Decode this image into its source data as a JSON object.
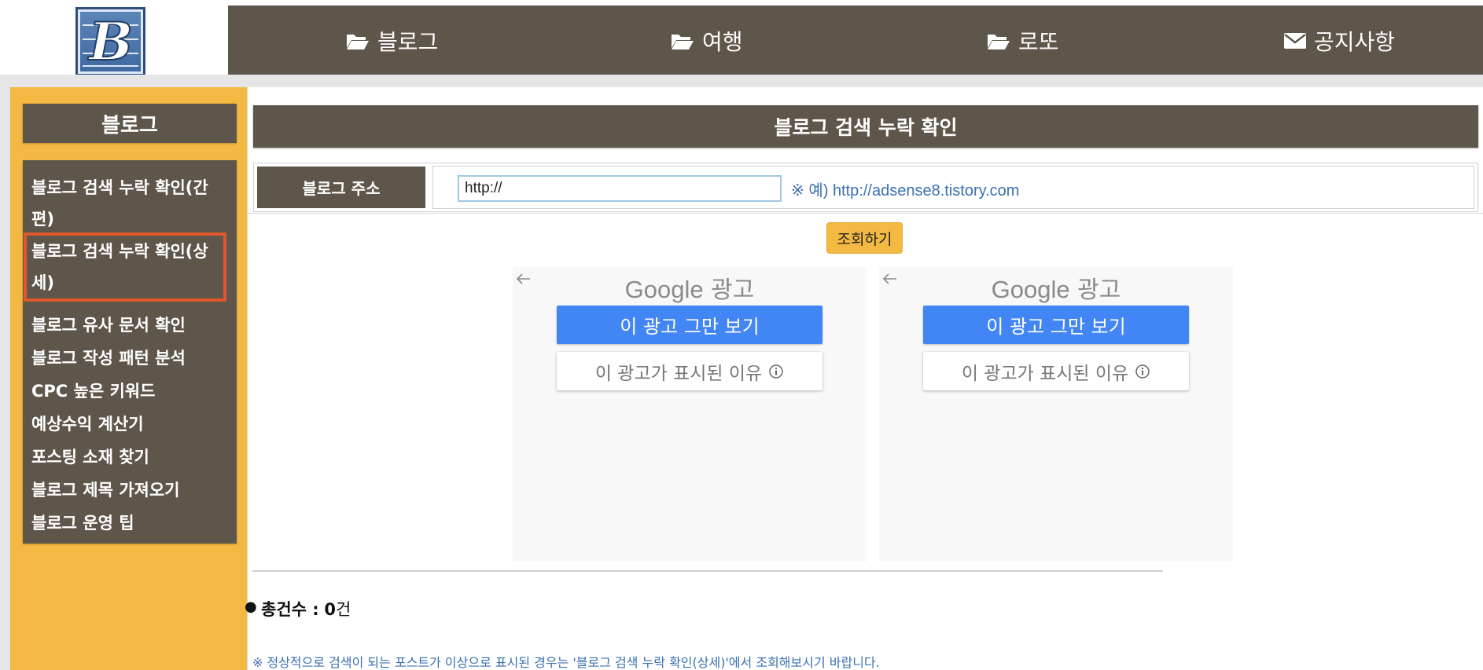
{
  "header": {
    "logo_letter": "B",
    "nav": [
      {
        "label": "블로그",
        "icon": "folder-open-icon"
      },
      {
        "label": "여행",
        "icon": "folder-open-icon"
      },
      {
        "label": "로또",
        "icon": "folder-open-icon"
      },
      {
        "label": "공지사항",
        "icon": "envelope-icon"
      }
    ]
  },
  "sidebar": {
    "title": "블로그",
    "items": [
      {
        "label": "블로그 검색 누락 확인(간편)"
      },
      {
        "label": "블로그 검색 누락 확인(상세)",
        "active": true
      },
      {
        "label": "블로그 유사 문서 확인"
      },
      {
        "label": "블로그 작성 패턴 분석"
      },
      {
        "label": "CPC 높은 키워드"
      },
      {
        "label": "예상수익 계산기"
      },
      {
        "label": "포스팅 소재 찾기"
      },
      {
        "label": "블로그 제목 가져오기"
      },
      {
        "label": "블로그 운영 팁"
      }
    ]
  },
  "main": {
    "title": "블로그 검색 누락 확인",
    "form": {
      "label": "블로그 주소",
      "url_value": "http://",
      "example_prefix": "※ 예)",
      "example_url": "http://adsense8.tistory.com"
    },
    "search_button": "조회하기",
    "ads": [
      {
        "brand": "Google",
        "brand_suffix": "광고",
        "stop_label": "이 광고 그만 보기",
        "why_label": "이 광고가 표시된 이유"
      },
      {
        "brand": "Google",
        "brand_suffix": "광고",
        "stop_label": "이 광고 그만 보기",
        "why_label": "이 광고가 표시된 이유"
      }
    ],
    "total": {
      "label": "총건수 :",
      "count": "0",
      "unit": "건"
    },
    "note": "※ 정상적으로 검색이 되는 포스트가 이상으로 표시된 경우는 '블로그 검색 누락 확인(상세)'에서 조회해보시기 바랍니다."
  },
  "colors": {
    "brown": "#5e564a",
    "yellow": "#f4b942",
    "active_outline": "#e0572b",
    "ad_blue": "#4285f4",
    "link_blue": "#3a6fb0"
  }
}
